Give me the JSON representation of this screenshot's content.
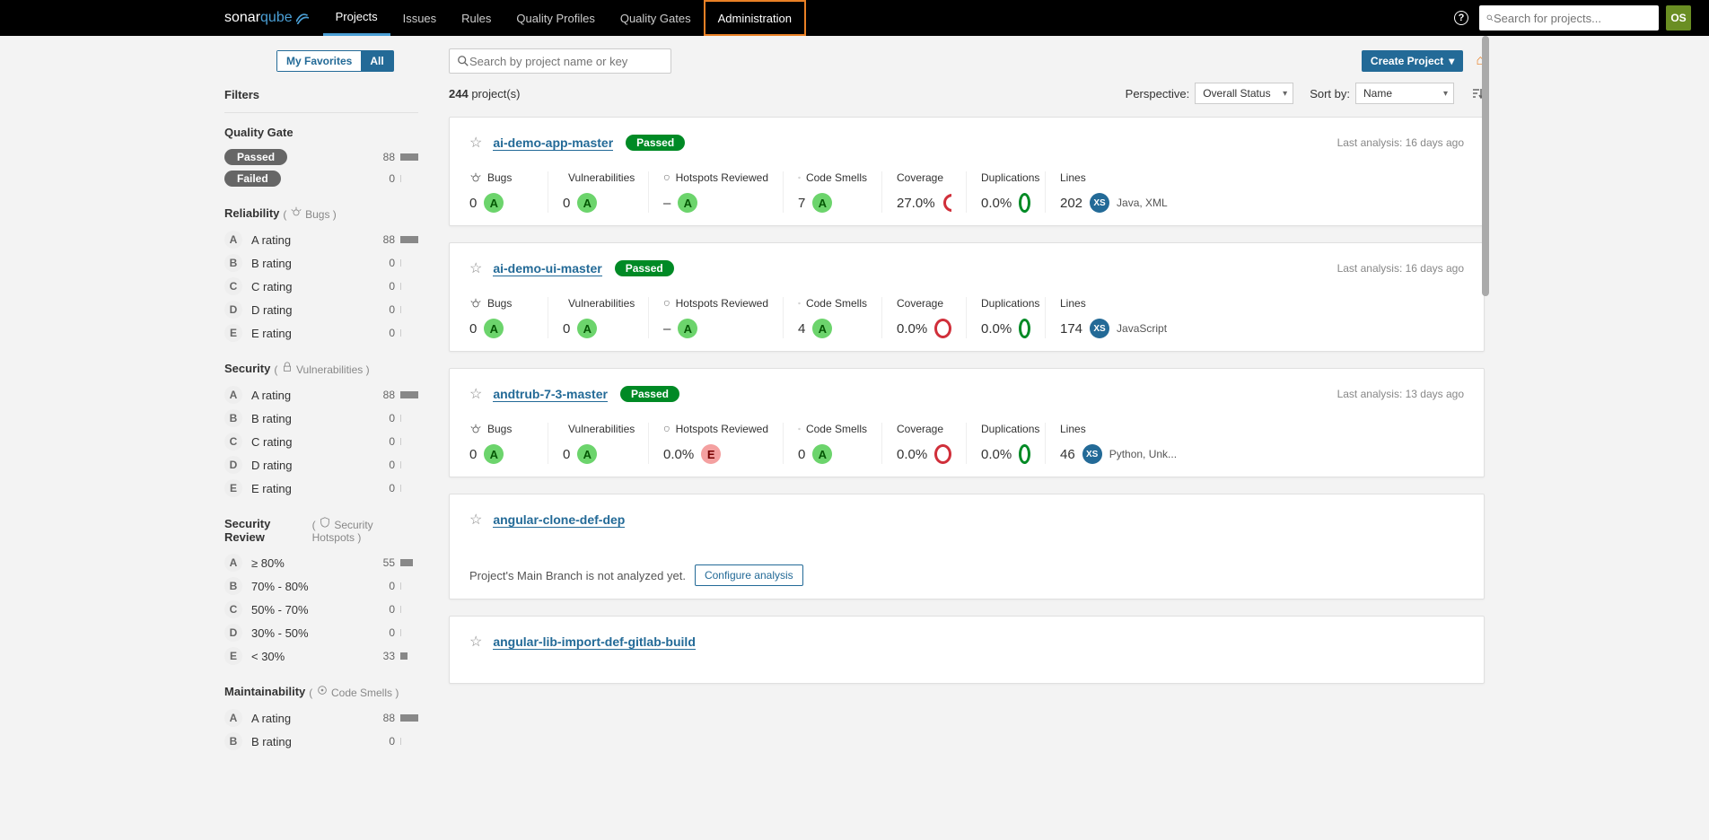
{
  "brand": {
    "p1": "sonar",
    "p2": "qube"
  },
  "nav": {
    "projects": "Projects",
    "issues": "Issues",
    "rules": "Rules",
    "profiles": "Quality Profiles",
    "gates": "Quality Gates",
    "admin": "Administration"
  },
  "search": {
    "placeholder": "Search for projects..."
  },
  "user": {
    "initials": "OS"
  },
  "tabs": {
    "fav": "My Favorites",
    "all": "All"
  },
  "filters": {
    "heading": "Filters",
    "qg": {
      "title": "Quality Gate",
      "passed": "Passed",
      "passed_n": "88",
      "failed": "Failed",
      "failed_n": "0"
    },
    "reliability": {
      "title": "Reliability",
      "sub": "Bugs"
    },
    "security": {
      "title": "Security",
      "sub": "Vulnerabilities"
    },
    "secrev": {
      "title": "Security Review",
      "sub": "Security Hotspots"
    },
    "maint": {
      "title": "Maintainability",
      "sub": "Code Smells"
    },
    "ratings": [
      {
        "letter": "A",
        "label": "A rating",
        "n": "88",
        "bar": 20
      },
      {
        "letter": "B",
        "label": "B rating",
        "n": "0",
        "bar": 0
      },
      {
        "letter": "C",
        "label": "C rating",
        "n": "0",
        "bar": 0
      },
      {
        "letter": "D",
        "label": "D rating",
        "n": "0",
        "bar": 0
      },
      {
        "letter": "E",
        "label": "E rating",
        "n": "0",
        "bar": 0
      }
    ],
    "secrev_rows": [
      {
        "letter": "A",
        "label": "≥ 80%",
        "n": "55",
        "bar": 14
      },
      {
        "letter": "B",
        "label": "70% - 80%",
        "n": "0",
        "bar": 0
      },
      {
        "letter": "C",
        "label": "50% - 70%",
        "n": "0",
        "bar": 0
      },
      {
        "letter": "D",
        "label": "30% - 50%",
        "n": "0",
        "bar": 0
      },
      {
        "letter": "E",
        "label": "< 30%",
        "n": "33",
        "bar": 8
      }
    ],
    "maint_rows": [
      {
        "letter": "A",
        "label": "A rating",
        "n": "88",
        "bar": 20
      },
      {
        "letter": "B",
        "label": "B rating",
        "n": "0",
        "bar": 0
      }
    ]
  },
  "main": {
    "search_ph": "Search by project name or key",
    "create": "Create Project",
    "count": "244",
    "count_suffix": " project(s)",
    "perspective_l": "Perspective:",
    "perspective": "Overall Status",
    "sortby_l": "Sort by:",
    "sortby": "Name",
    "headers": {
      "bugs": "Bugs",
      "vuln": "Vulnerabilities",
      "hot": "Hotspots Reviewed",
      "smells": "Code Smells",
      "cov": "Coverage",
      "dup": "Duplications",
      "lines": "Lines"
    },
    "not_analyzed": "Project's Main Branch is not analyzed yet.",
    "configure": "Configure analysis"
  },
  "projects": [
    {
      "name": "ai-demo-app-master",
      "status": "Passed",
      "analysis": "Last analysis: 16 days ago",
      "bugs": "0",
      "vuln": "0",
      "hot": "–",
      "smells": "7",
      "cov": "27.0%",
      "covtype": "partial",
      "dup": "0.0%",
      "lines": "202",
      "size": "XS",
      "langs": "Java, XML"
    },
    {
      "name": "ai-demo-ui-master",
      "status": "Passed",
      "analysis": "Last analysis: 16 days ago",
      "bugs": "0",
      "vuln": "0",
      "hot": "–",
      "smells": "4",
      "cov": "0.0%",
      "covtype": "red",
      "dup": "0.0%",
      "lines": "174",
      "size": "XS",
      "langs": "JavaScript"
    },
    {
      "name": "andtrub-7-3-master",
      "status": "Passed",
      "analysis": "Last analysis: 13 days ago",
      "bugs": "0",
      "vuln": "0",
      "hot": "0.0%",
      "hotrating": "E",
      "smells": "0",
      "cov": "0.0%",
      "covtype": "red",
      "dup": "0.0%",
      "lines": "46",
      "size": "XS",
      "langs": "Python, Unk..."
    },
    {
      "name": "angular-clone-def-dep",
      "notanalyzed": true
    },
    {
      "name": "angular-lib-import-def-gitlab-build",
      "notanalyzed": true
    }
  ]
}
